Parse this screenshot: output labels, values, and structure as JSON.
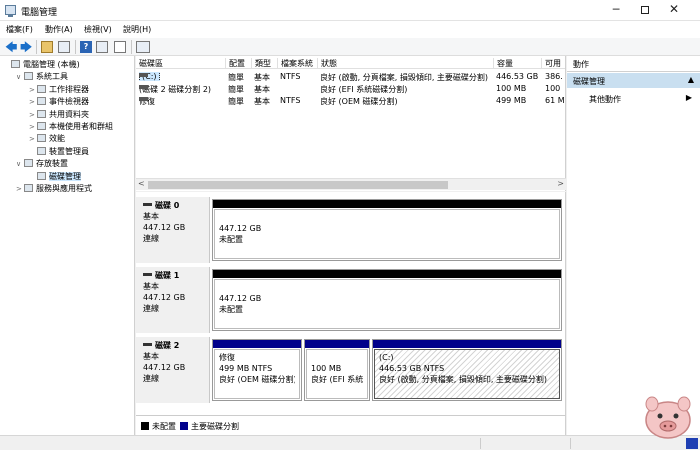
{
  "window": {
    "title": "電腦管理",
    "minimize": "─",
    "close": "✕"
  },
  "menu": [
    {
      "label": "檔案(F)"
    },
    {
      "label": "動作(A)"
    },
    {
      "label": "檢視(V)"
    },
    {
      "label": "說明(H)"
    }
  ],
  "toolbar": {
    "back": "🡄",
    "forward": "🡆",
    "help": "?"
  },
  "tree": {
    "items": [
      {
        "label": "電腦管理 (本機)",
        "level": 0,
        "twisty": "",
        "selected": false
      },
      {
        "label": "系統工具",
        "level": 1,
        "twisty": "∨",
        "selected": false
      },
      {
        "label": "工作排程器",
        "level": 2,
        "twisty": ">",
        "selected": false
      },
      {
        "label": "事件檢視器",
        "level": 2,
        "twisty": ">",
        "selected": false
      },
      {
        "label": "共用資料夾",
        "level": 2,
        "twisty": ">",
        "selected": false
      },
      {
        "label": "本機使用者和群組",
        "level": 2,
        "twisty": ">",
        "selected": false
      },
      {
        "label": "效能",
        "level": 2,
        "twisty": ">",
        "selected": false
      },
      {
        "label": "裝置管理員",
        "level": 2,
        "twisty": "",
        "selected": false
      },
      {
        "label": "存放裝置",
        "level": 1,
        "twisty": "∨",
        "selected": false
      },
      {
        "label": "磁碟管理",
        "level": 2,
        "twisty": "",
        "selected": true
      },
      {
        "label": "服務與應用程式",
        "level": 1,
        "twisty": ">",
        "selected": false
      }
    ]
  },
  "volume_list": {
    "columns": [
      "磁碟區",
      "配置",
      "類型",
      "檔案系統",
      "狀態",
      "容量",
      "可用"
    ],
    "rows": [
      {
        "name": "(C:)",
        "layout": "簡單",
        "type": "基本",
        "fs": "NTFS",
        "status": "良好 (啟動, 分頁檔案, 損毀傾印, 主要磁碟分割)",
        "capacity": "446.53 GB",
        "free": "386."
      },
      {
        "name": "(磁碟 2 磁碟分割 2)",
        "layout": "簡單",
        "type": "基本",
        "fs": "",
        "status": "良好 (EFI 系統磁碟分割)",
        "capacity": "100 MB",
        "free": "100"
      },
      {
        "name": "修復",
        "layout": "簡單",
        "type": "基本",
        "fs": "NTFS",
        "status": "良好 (OEM 磁碟分割)",
        "capacity": "499 MB",
        "free": "61 M"
      }
    ],
    "scroll_left": "<",
    "scroll_right": ">"
  },
  "disks": [
    {
      "name": "磁碟 0",
      "type": "基本",
      "size": "447.12 GB",
      "state": "連線",
      "partitions": [
        {
          "title": "",
          "size": "447.12 GB",
          "status": "未配置",
          "color": "#000000",
          "hatched": false
        }
      ]
    },
    {
      "name": "磁碟 1",
      "type": "基本",
      "size": "447.12 GB",
      "state": "連線",
      "partitions": [
        {
          "title": "",
          "size": "447.12 GB",
          "status": "未配置",
          "color": "#000000",
          "hatched": false
        }
      ]
    },
    {
      "name": "磁碟 2",
      "type": "基本",
      "size": "447.12 GB",
      "state": "連線",
      "partitions": [
        {
          "title": "修復",
          "size": "499 MB NTFS",
          "status": "良好 (OEM 磁碟分割)",
          "color": "#00008b",
          "hatched": false
        },
        {
          "title": "",
          "size": "100 MB",
          "status": "良好 (EFI 系統磁碟",
          "color": "#00008b",
          "hatched": false
        },
        {
          "title": "(C:)",
          "size": "446.53 GB NTFS",
          "status": "良好 (啟動, 分頁檔案, 損毀傾印, 主要磁碟分割)",
          "color": "#00008b",
          "hatched": true
        }
      ]
    }
  ],
  "legend": [
    {
      "label": "未配置",
      "color": "#000000"
    },
    {
      "label": "主要磁碟分割",
      "color": "#00008b"
    }
  ],
  "actions": {
    "header": "動作",
    "group": "磁碟管理",
    "group_caret": "▲",
    "more": "其他動作",
    "more_caret": "▶"
  }
}
